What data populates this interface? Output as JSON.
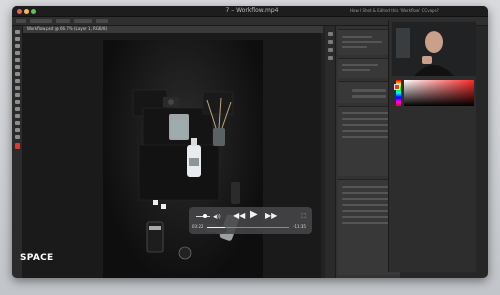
{
  "window": {
    "title": "7 – Workflow.mp4",
    "secondary_title": "How I Shot & Edited this 'Workflow' CCvaps?"
  },
  "document_tab": {
    "label": "Workflow.psd @ 66.7% (Layer 1, RGB/8)"
  },
  "video": {
    "rewind_icon": "rewind-icon",
    "play_icon": "play-icon",
    "forward_icon": "fast-forward-icon",
    "elapsed": "03:22",
    "remaining": "-11:35",
    "progress": 0.22,
    "volume": 0.65
  },
  "overlay_text": "SPACE",
  "colors": {
    "foreground": "#e0382f",
    "accent_red": "#ff2a2a"
  }
}
